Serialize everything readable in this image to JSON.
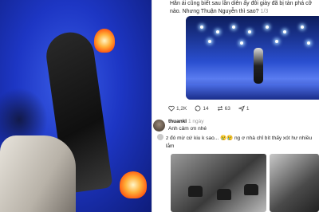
{
  "post": {
    "text": "Hắn ái cũng biết sau lần diễn ấy đôi giày đã bị tàn phá cỡ nào. Nhưng Thuận Nguyễn thì sao?",
    "counter": "1/3"
  },
  "actions": {
    "likes": "1,2K",
    "comments": "14",
    "reposts": "63",
    "shares": "1"
  },
  "comment": {
    "username": "thuankl",
    "time": "1 ngày",
    "text": "Anh cảm ơn nhé"
  },
  "reply": {
    "text": "z đó mừ cứ kiu k sao... 😢😢 ng ơ nhà chỉ bít thấy xót hư nhiều lắm"
  },
  "colors": {
    "stage_blue": "#1d36c4",
    "text_primary": "#111111",
    "text_muted": "#999999"
  }
}
